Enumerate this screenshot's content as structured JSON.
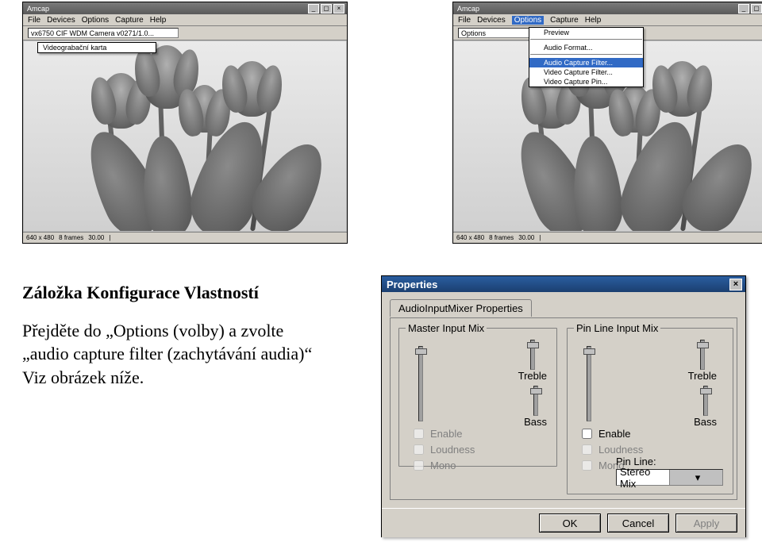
{
  "thumb_common": {
    "title": "Amcap",
    "menu": {
      "file": "File",
      "devices": "Devices",
      "options": "Options",
      "capture": "Capture",
      "help": "Help"
    },
    "status": {
      "cell1": "640 x 480",
      "cell2": "8 frames",
      "cell3": "30.00",
      "cell4": "|"
    }
  },
  "thumb_left": {
    "device_value": "vx6750 CIF WDM Camera v0271/1.0...",
    "submenu_item": "Videograbační karta"
  },
  "thumb_right": {
    "options_value": "Options",
    "menu_items": {
      "preview": "Preview",
      "audio_format": "Audio Format...",
      "sep": "",
      "hi": "Audio Capture Filter...",
      "video_filter": "Video Capture Filter...",
      "video_pin": "Video Capture Pin..."
    }
  },
  "article": {
    "heading": "Záložka Konfigurace Vlastností",
    "p1_a": "Přejděte do „Options (volby) a zvolte",
    "p1_b": "„audio capture filter (zachytávání audia)“",
    "p1_c": "Viz obrázek níže."
  },
  "props": {
    "title": "Properties",
    "tab": "AudioInputMixer Properties",
    "master_group": "Master Input Mix",
    "pin_group": "Pin Line Input Mix",
    "treble": "Treble",
    "bass": "Bass",
    "enable": "Enable",
    "loudness": "Loudness",
    "mono": "Mono",
    "pin_line_label": "Pin Line:",
    "pin_line_value": "Stereo Mix",
    "ok": "OK",
    "cancel": "Cancel",
    "apply": "Apply"
  }
}
